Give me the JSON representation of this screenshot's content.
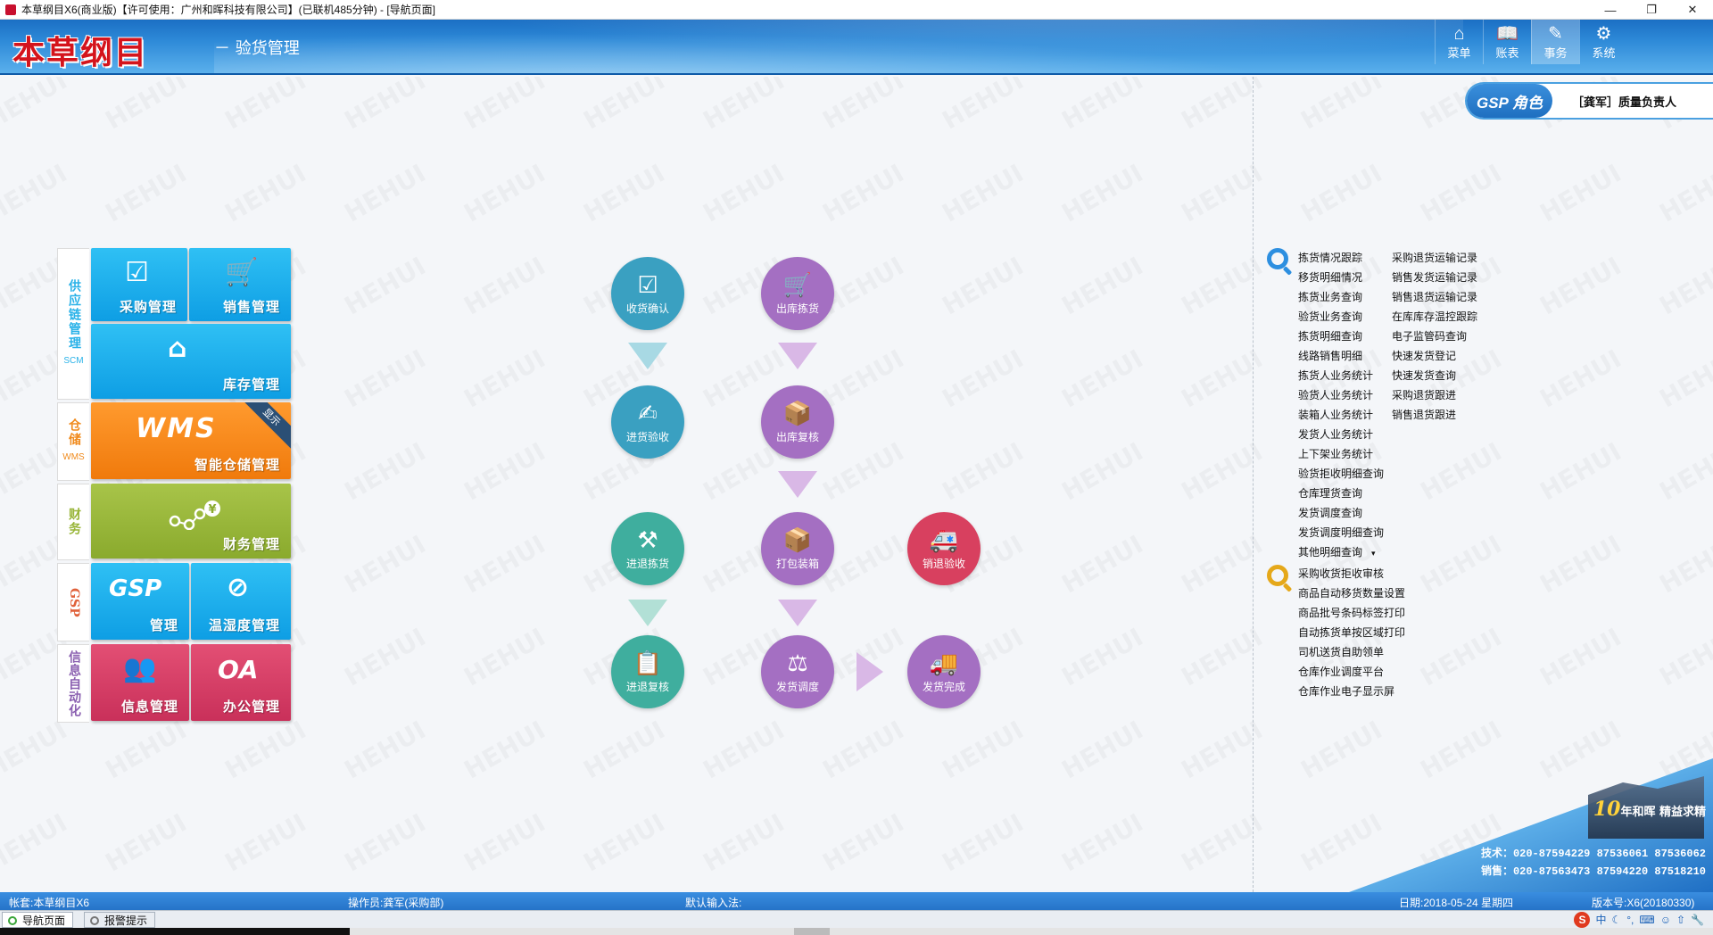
{
  "window": {
    "title": "本草纲目X6(商业版)【许可使用：广州和晖科技有限公司】(已联机485分钟) - [导航页面]",
    "controls": [
      "—",
      "❐",
      "✕"
    ]
  },
  "header": {
    "logo": "本草纲目",
    "subtitle": "－ 验货管理",
    "nav": [
      {
        "label": "菜单",
        "icon": "home-icon",
        "glyph": "⌂"
      },
      {
        "label": "账表",
        "icon": "book-icon",
        "glyph": "📖"
      },
      {
        "label": "事务",
        "icon": "edit-icon",
        "glyph": "✎"
      },
      {
        "label": "系统",
        "icon": "gear-icon",
        "glyph": "⚙"
      }
    ]
  },
  "watermark": "HEHUI",
  "gsp_role": {
    "badge": "GSP 角色",
    "user": "［龚军］质量负责人"
  },
  "modules": {
    "scm": {
      "label": "供应链管理",
      "sub": "SCM",
      "color": "#2ab2e8",
      "tiles": [
        {
          "label": "采购管理",
          "icon": "purchase-order-icon",
          "glyph": "☑"
        },
        {
          "label": "销售管理",
          "icon": "shopping-cart-icon",
          "glyph": "🛒"
        },
        {
          "label": "库存管理",
          "icon": "warehouse-icon",
          "glyph": "⌂"
        }
      ]
    },
    "wms": {
      "label": "仓储",
      "sub": "WMS",
      "color": "#f08a1c",
      "tile": {
        "label": "智能仓储管理",
        "logo": "WMS",
        "ribbon": "显示"
      }
    },
    "finance": {
      "label": "财务",
      "color": "#98b538",
      "tile": {
        "label": "财务管理",
        "icon": "finance-network-icon",
        "glyph": "¥"
      }
    },
    "gsp": {
      "label": "GSP",
      "color": "#e0613a",
      "tiles": [
        {
          "label": "管理",
          "logo": "GSP"
        },
        {
          "label": "温湿度管理",
          "icon": "compass-icon",
          "glyph": "⊘"
        }
      ]
    },
    "oa": {
      "label": "信息自动化",
      "color": "#8a5fb0",
      "tiles": [
        {
          "label": "信息管理",
          "icon": "users-icon",
          "glyph": "👥"
        },
        {
          "label": "办公管理",
          "logo": "OA"
        }
      ]
    }
  },
  "flow": {
    "nodes": [
      {
        "id": "receive-confirm",
        "label": "收货确认",
        "glyph": "☑",
        "icon": "check-box-icon"
      },
      {
        "id": "stock-check",
        "label": "进货验收",
        "glyph": "✍",
        "icon": "inspect-icon"
      },
      {
        "id": "return-pick",
        "label": "进退拣货",
        "glyph": "⚒",
        "icon": "picker-icon"
      },
      {
        "id": "return-review",
        "label": "进退复核",
        "glyph": "📋",
        "icon": "clipboard-icon"
      },
      {
        "id": "out-pick",
        "label": "出库拣货",
        "glyph": "🛒",
        "icon": "trolley-icon"
      },
      {
        "id": "out-review",
        "label": "出库复核",
        "glyph": "📦",
        "icon": "box-worker-icon"
      },
      {
        "id": "pack",
        "label": "打包装箱",
        "glyph": "📦",
        "icon": "pack-icon"
      },
      {
        "id": "dispatch",
        "label": "发货调度",
        "glyph": "⚖",
        "icon": "dispatch-icon"
      },
      {
        "id": "sales-return-check",
        "label": "销退验收",
        "glyph": "🚑",
        "icon": "truck-return-icon"
      },
      {
        "id": "shipped",
        "label": "发货完成",
        "glyph": "🚚",
        "icon": "delivery-truck-icon"
      }
    ]
  },
  "links": {
    "query_col1": [
      "拣货情况跟踪",
      "移货明细情况",
      "拣货业务查询",
      "验货业务查询",
      "拣货明细查询",
      "线路销售明细",
      "拣货人业务统计",
      "验货人业务统计",
      "装箱人业务统计",
      "发货人业务统计",
      "上下架业务统计",
      "验货拒收明细查询",
      "仓库理货查询",
      "发货调度查询",
      "发货调度明细查询",
      "其他明细查询"
    ],
    "query_col2": [
      "采购退货运输记录",
      "销售发货运输记录",
      "销售退货运输记录",
      "在库库存温控跟踪",
      "电子监管码查询",
      "快速发货登记",
      "快速发货查询",
      "采购退货跟进",
      "销售退货跟进"
    ],
    "tools": [
      "采购收货拒收审核",
      "商品自动移货数量设置",
      "商品批号条码标签打印",
      "自动拣货单按区域打印",
      "司机送货自助领单",
      "仓库作业调度平台",
      "仓库作业电子显示屏"
    ],
    "more_caret": "▾"
  },
  "banner": {
    "slogan_num": "10",
    "slogan": "年和晖 精益求精",
    "tech": "技术：020-87594229  87536061  87536062",
    "sales": "销售：020-87563473  87594220  87518210"
  },
  "status": {
    "account": "帐套:本草纲目X6",
    "operator": "操作员:龚军(采购部)",
    "input": "默认输入法:",
    "date": "日期:2018-05-24 星期四",
    "version": "版本号:X6(20180330)"
  },
  "tabs": [
    {
      "label": "导航页面",
      "active": true
    },
    {
      "label": "报警提示",
      "active": false
    }
  ],
  "ime": {
    "s": "S",
    "lang": "中"
  }
}
